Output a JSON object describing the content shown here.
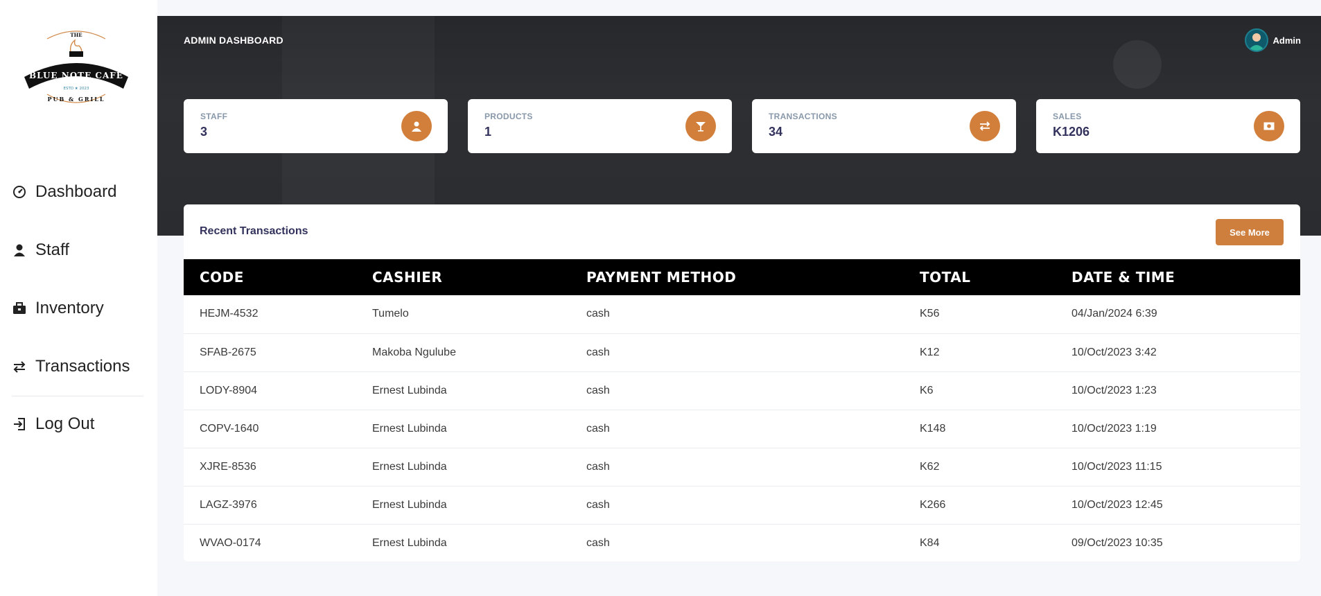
{
  "logo": {
    "top_text": "THE",
    "name": "BLUE NOTE CAFE",
    "estd": "ESTD ★ 2023",
    "bottom_text": "PUB & GRILL"
  },
  "sidebar": {
    "items": [
      {
        "label": "Dashboard",
        "icon": "dashboard-gauge-icon"
      },
      {
        "label": "Staff",
        "icon": "person-icon"
      },
      {
        "label": "Inventory",
        "icon": "briefcase-icon"
      },
      {
        "label": "Transactions",
        "icon": "arrows-exchange-icon"
      }
    ],
    "logout": {
      "label": "Log Out",
      "icon": "logout-icon"
    }
  },
  "header": {
    "title": "ADMIN DASHBOARD",
    "user_name": "Admin"
  },
  "stats": [
    {
      "label": "STAFF",
      "value": "3",
      "icon": "person-icon"
    },
    {
      "label": "PRODUCTS",
      "value": "1",
      "icon": "cocktail-glass-icon"
    },
    {
      "label": "TRANSACTIONS",
      "value": "34",
      "icon": "arrows-exchange-icon"
    },
    {
      "label": "SALES",
      "value": "K1206",
      "icon": "money-bill-icon"
    }
  ],
  "recent": {
    "title": "Recent Transactions",
    "see_more_label": "See More",
    "columns": [
      "CODE",
      "CASHIER",
      "PAYMENT METHOD",
      "TOTAL",
      "DATE & TIME"
    ],
    "rows": [
      [
        "HEJM-4532",
        "Tumelo",
        "cash",
        "K56",
        "04/Jan/2024 6:39"
      ],
      [
        "SFAB-2675",
        "Makoba Ngulube",
        "cash",
        "K12",
        "10/Oct/2023 3:42"
      ],
      [
        "LODY-8904",
        "Ernest Lubinda",
        "cash",
        "K6",
        "10/Oct/2023 1:23"
      ],
      [
        "COPV-1640",
        "Ernest Lubinda",
        "cash",
        "K148",
        "10/Oct/2023 1:19"
      ],
      [
        "XJRE-8536",
        "Ernest Lubinda",
        "cash",
        "K62",
        "10/Oct/2023 11:15"
      ],
      [
        "LAGZ-3976",
        "Ernest Lubinda",
        "cash",
        "K266",
        "10/Oct/2023 12:45"
      ],
      [
        "WVAO-0174",
        "Ernest Lubinda",
        "cash",
        "K84",
        "09/Oct/2023 10:35"
      ]
    ]
  },
  "colors": {
    "accent": "#cf7f3d",
    "banner": "#2a2c30",
    "table_header": "#000000",
    "text": "#32325d"
  }
}
